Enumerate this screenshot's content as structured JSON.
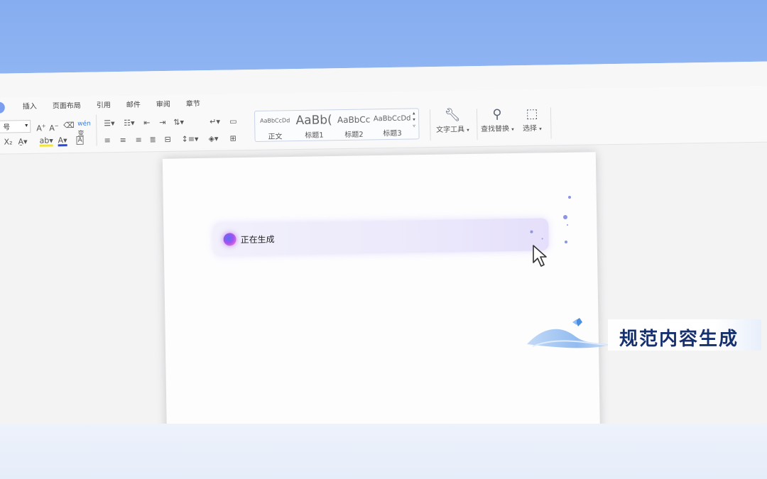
{
  "menu_tabs": [
    "插入",
    "页面布局",
    "引用",
    "邮件",
    "审阅",
    "章节"
  ],
  "font_size_value": "号",
  "styles": [
    {
      "sample": "AaBbCcDd",
      "name": "正文"
    },
    {
      "sample": "AaBb(",
      "name": "标题1"
    },
    {
      "sample": "AaBbCc",
      "name": "标题2"
    },
    {
      "sample": "AaBbCcDd",
      "name": "标题3"
    }
  ],
  "tools": {
    "text_tools": "文字工具",
    "find_replace": "查找替换",
    "select": "选择"
  },
  "generation": {
    "status_text": "正在生成"
  },
  "feature_caption": "规范内容生成",
  "colors": {
    "accent": "#7c9ef0",
    "caption_text": "#16306e",
    "gen_bar": "#ece9fb"
  },
  "icons": {
    "text_tools": "wrench-icon",
    "find_replace": "search-icon",
    "select": "select-icon",
    "cursor": "mouse-pointer-icon",
    "orb": "ai-orb-icon"
  }
}
